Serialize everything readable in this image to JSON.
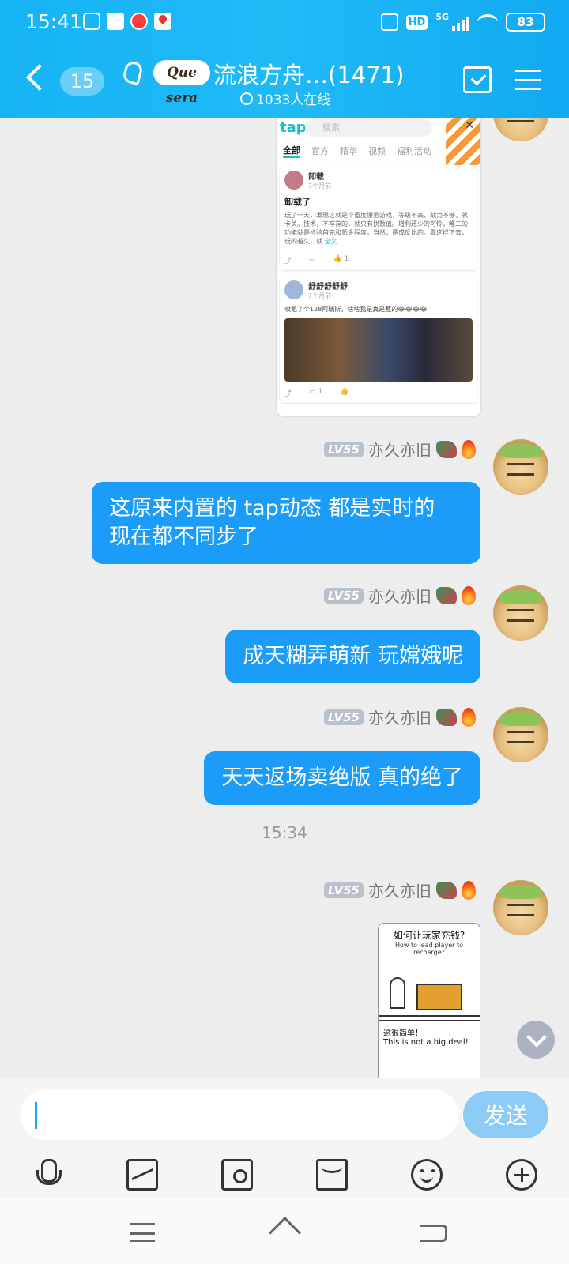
{
  "status_bar": {
    "time": "15:41",
    "app_icons": [
      "tv-icon",
      "app-icon",
      "weibo-icon",
      "map-icon"
    ],
    "hd_label": "HD",
    "network_label": "5G",
    "battery_percent": "83"
  },
  "header": {
    "unread_count": "15",
    "logo_text": "Que sera",
    "group_title": "流浪方舟…(1471)",
    "online_count": "1033人在线"
  },
  "colors": {
    "header_bg": "#19b0f2",
    "bubble_bg": "#1b9cf9",
    "send_button_bg": "#8ccbf6"
  },
  "image_post": {
    "app_logo": "tap",
    "search_placeholder": "搜索",
    "tabs": [
      "全部",
      "官方",
      "精华",
      "视频",
      "福利活动"
    ],
    "post1": {
      "user": "卸载",
      "time": "7个月前",
      "title": "卸载了",
      "text": "玩了一天，发现这就是个重度爆氪游戏，等级不高、战力不够，就卡关。技术，不存存的，就只有拼数值。增利还少的可怜，唯二的功能就是检验首充和氪金程度，当然，是成反比的。靠这样下去，玩的越久，就",
      "more": "全文",
      "likes": "1"
    },
    "post2": {
      "user": "舒舒舒舒舒",
      "time": "7个月前",
      "text": "收氪了个128阿瑞斯，啥啥我是真是惹的😂😂😂😂",
      "comments": "1"
    }
  },
  "messages": [
    {
      "level": "LV55",
      "sender": "亦久亦旧",
      "text": "这原来内置的 tap动态 都是实时的 现在都不同步了"
    },
    {
      "level": "LV55",
      "sender": "亦久亦旧",
      "text": "成天糊弄萌新 玩嫦娥呢"
    },
    {
      "level": "LV55",
      "sender": "亦久亦旧",
      "text": "天天返场卖绝版 真的绝了"
    }
  ],
  "timestamp": "15:34",
  "last_message": {
    "level": "LV55",
    "sender": "亦久亦旧",
    "comic": {
      "panel1_title": "如何让玩家充钱?",
      "panel1_sub": "How to lead player to recharge?",
      "panel2_title": "这很简单！",
      "panel2_sub": "This is not a big deal!"
    }
  },
  "input": {
    "value": "",
    "send_label": "发送"
  },
  "toolbar_icons": [
    "mic-icon",
    "image-icon",
    "camera-icon",
    "red-packet-icon",
    "emoji-icon",
    "plus-icon"
  ]
}
